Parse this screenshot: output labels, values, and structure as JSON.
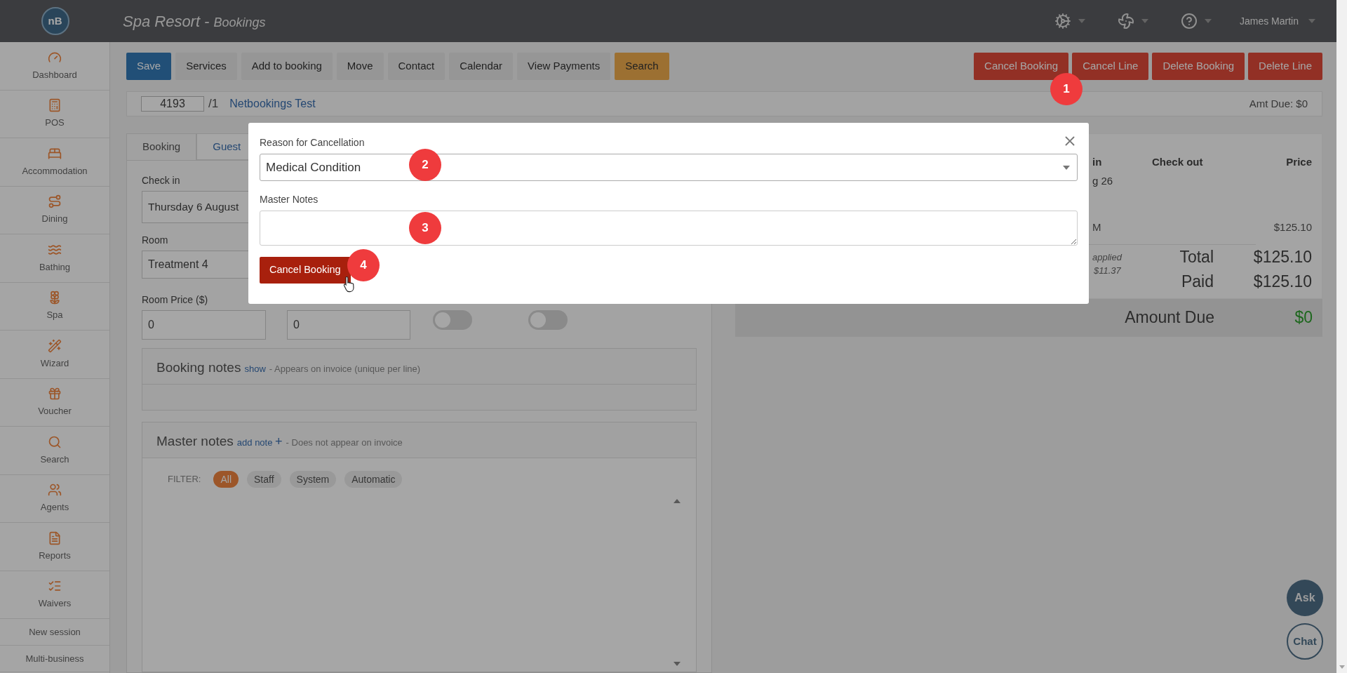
{
  "header": {
    "logo": "nB",
    "title": "Spa Resort",
    "separator": "-",
    "section": "Bookings",
    "user": "James Martin"
  },
  "sidebar": {
    "items": [
      {
        "label": "Dashboard"
      },
      {
        "label": "POS"
      },
      {
        "label": "Accommodation"
      },
      {
        "label": "Dining"
      },
      {
        "label": "Bathing"
      },
      {
        "label": "Spa"
      },
      {
        "label": "Wizard"
      },
      {
        "label": "Voucher"
      },
      {
        "label": "Search"
      },
      {
        "label": "Agents"
      },
      {
        "label": "Reports"
      },
      {
        "label": "Waivers"
      }
    ],
    "links": [
      "New session",
      "Multi-business"
    ]
  },
  "toolbar": {
    "left": [
      {
        "label": "Save",
        "kind": "primary"
      },
      {
        "label": "Services",
        "kind": "default"
      },
      {
        "label": "Add to booking",
        "kind": "default"
      },
      {
        "label": "Move",
        "kind": "default"
      },
      {
        "label": "Contact",
        "kind": "default"
      },
      {
        "label": "Calendar",
        "kind": "default"
      },
      {
        "label": "View Payments",
        "kind": "default"
      },
      {
        "label": "Search",
        "kind": "warning"
      }
    ],
    "right": [
      "Cancel Booking",
      "Cancel Line",
      "Delete Booking",
      "Delete Line"
    ]
  },
  "booking_bar": {
    "number": "4193",
    "line": "/1",
    "name": "Netbookings Test",
    "amount_due": "Amt Due: $0"
  },
  "tabs": [
    {
      "label": "Booking",
      "selected": true
    },
    {
      "label": "Guest",
      "selected": false
    }
  ],
  "form": {
    "check_in_label": "Check in",
    "check_in_value": "Thursday 6 August",
    "room_label": "Room",
    "room_value": "Treatment 4",
    "price_label": "Room Price ($)",
    "price_value": "0",
    "second_value": "0",
    "toggles": [
      {
        "on": false
      },
      {
        "on": false
      }
    ]
  },
  "booking_notes": {
    "title": "Booking notes",
    "link": "show",
    "note": "- Appears on invoice (unique per line)"
  },
  "master_notes": {
    "title": "Master notes",
    "link": "add note",
    "plus": "+",
    "note": "- Does not appear on invoice",
    "filter_label": "FILTER:",
    "chips": [
      {
        "label": "All",
        "selected": true
      },
      {
        "label": "Staff",
        "selected": false
      },
      {
        "label": "System",
        "selected": false
      },
      {
        "label": "Automatic",
        "selected": false
      }
    ]
  },
  "summary": {
    "col_1": "in",
    "check_out": "Check out",
    "price": "Price",
    "row_date": "g 26",
    "row_time": "M",
    "row_price": "$125.10",
    "tax_line_1": "applied",
    "tax_line_2": "$11.37",
    "total_label": "Total",
    "total_value": "$125.10",
    "paid_label": "Paid",
    "paid_value": "$125.10",
    "due_label": "Amount Due",
    "due_value": "$0"
  },
  "modal": {
    "reason_label": "Reason for Cancellation",
    "reason_value": "Medical Condition",
    "notes_label": "Master Notes",
    "button": "Cancel Booking"
  },
  "markers": [
    "1",
    "2",
    "3",
    "4"
  ],
  "help": {
    "ask": "Ask",
    "chat": "Chat"
  }
}
